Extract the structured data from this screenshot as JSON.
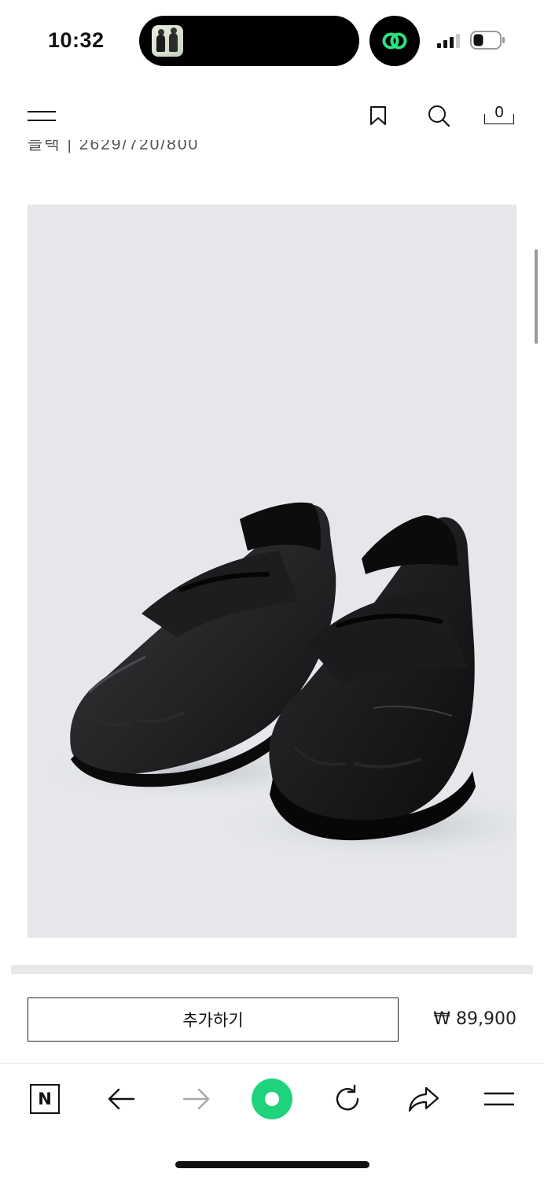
{
  "status_bar": {
    "time": "10:32"
  },
  "header": {
    "bag_count": "0"
  },
  "product": {
    "subline": "블랙 | 2629/720/800",
    "image_alt": "black leather penny loafers"
  },
  "purchase": {
    "add_label": "추가하기",
    "price": "₩ 89,900"
  },
  "browser_toolbar": {
    "naver_label": "N"
  },
  "colors": {
    "accent_green": "#1fd37c",
    "image_background": "#e5e7ea"
  }
}
